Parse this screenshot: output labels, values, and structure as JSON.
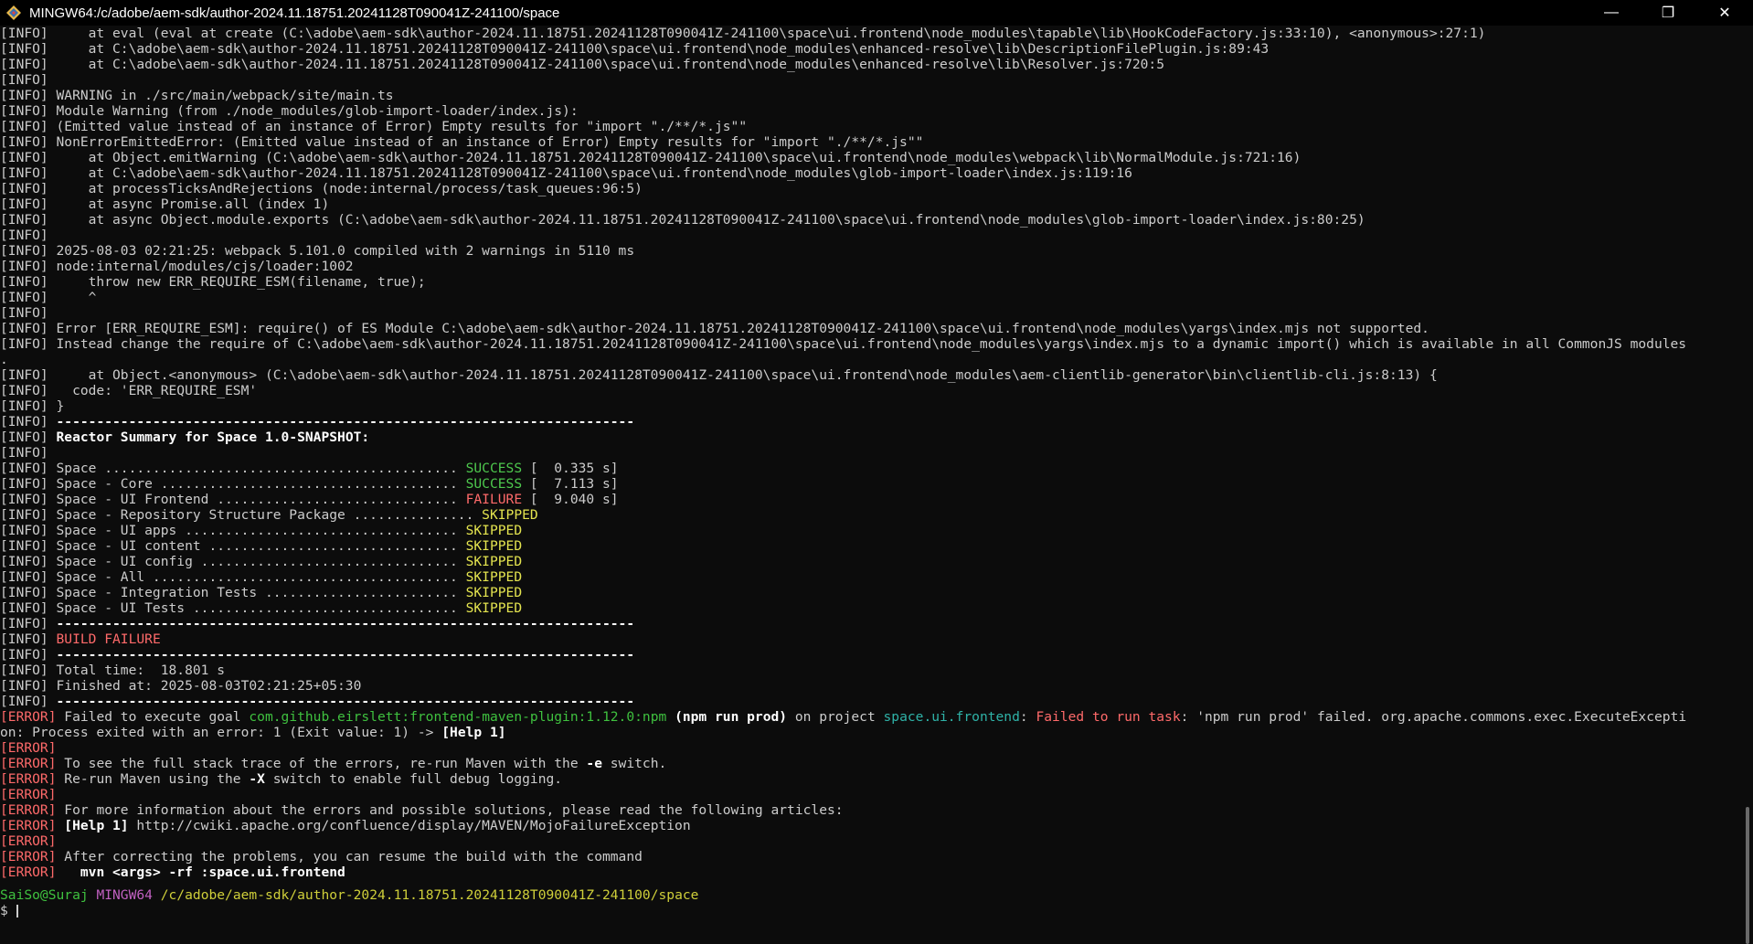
{
  "window": {
    "title": "MINGW64:/c/adobe/aem-sdk/author-2024.11.18751.20241128T090041Z-241100/space",
    "controls": {
      "minimize": "—",
      "maximize": "❐",
      "close": "✕"
    }
  },
  "terminal": {
    "lines": [
      [
        [
          "info",
          "[INFO]     at eval (eval at create (C:\\adobe\\aem-sdk\\author-2024.11.18751.20241128T090041Z-241100\\space\\ui.frontend\\node_modules\\tapable\\lib\\HookCodeFactory.js:33:10), <anonymous>:27:1)"
        ]
      ],
      [
        [
          "info",
          "[INFO]     at C:\\adobe\\aem-sdk\\author-2024.11.18751.20241128T090041Z-241100\\space\\ui.frontend\\node_modules\\enhanced-resolve\\lib\\DescriptionFilePlugin.js:89:43"
        ]
      ],
      [
        [
          "info",
          "[INFO]     at C:\\adobe\\aem-sdk\\author-2024.11.18751.20241128T090041Z-241100\\space\\ui.frontend\\node_modules\\enhanced-resolve\\lib\\Resolver.js:720:5"
        ]
      ],
      [
        [
          "info",
          "[INFO]"
        ]
      ],
      [
        [
          "info",
          "[INFO] WARNING in ./src/main/webpack/site/main.ts"
        ]
      ],
      [
        [
          "info",
          "[INFO] Module Warning (from ./node_modules/glob-import-loader/index.js):"
        ]
      ],
      [
        [
          "info",
          "[INFO] (Emitted value instead of an instance of Error) Empty results for \"import \"./**/*.js\"\""
        ]
      ],
      [
        [
          "info",
          "[INFO] NonErrorEmittedError: (Emitted value instead of an instance of Error) Empty results for \"import \"./**/*.js\"\""
        ]
      ],
      [
        [
          "info",
          "[INFO]     at Object.emitWarning (C:\\adobe\\aem-sdk\\author-2024.11.18751.20241128T090041Z-241100\\space\\ui.frontend\\node_modules\\webpack\\lib\\NormalModule.js:721:16)"
        ]
      ],
      [
        [
          "info",
          "[INFO]     at C:\\adobe\\aem-sdk\\author-2024.11.18751.20241128T090041Z-241100\\space\\ui.frontend\\node_modules\\glob-import-loader\\index.js:119:16"
        ]
      ],
      [
        [
          "info",
          "[INFO]     at processTicksAndRejections (node:internal/process/task_queues:96:5)"
        ]
      ],
      [
        [
          "info",
          "[INFO]     at async Promise.all (index 1)"
        ]
      ],
      [
        [
          "info",
          "[INFO]     at async Object.module.exports (C:\\adobe\\aem-sdk\\author-2024.11.18751.20241128T090041Z-241100\\space\\ui.frontend\\node_modules\\glob-import-loader\\index.js:80:25)"
        ]
      ],
      [
        [
          "info",
          "[INFO]"
        ]
      ],
      [
        [
          "info",
          "[INFO] 2025-08-03 02:21:25: webpack 5.101.0 compiled with 2 warnings in 5110 ms"
        ]
      ],
      [
        [
          "info",
          "[INFO] node:internal/modules/cjs/loader:1002"
        ]
      ],
      [
        [
          "info",
          "[INFO]     throw new ERR_REQUIRE_ESM(filename, true);"
        ]
      ],
      [
        [
          "info",
          "[INFO]     ^"
        ]
      ],
      [
        [
          "info",
          "[INFO]"
        ]
      ],
      [
        [
          "info",
          "[INFO] Error [ERR_REQUIRE_ESM]: require() of ES Module C:\\adobe\\aem-sdk\\author-2024.11.18751.20241128T090041Z-241100\\space\\ui.frontend\\node_modules\\yargs\\index.mjs not supported."
        ]
      ],
      [
        [
          "info",
          "[INFO] Instead change the require of C:\\adobe\\aem-sdk\\author-2024.11.18751.20241128T090041Z-241100\\space\\ui.frontend\\node_modules\\yargs\\index.mjs to a dynamic import() which is available in all CommonJS modules"
        ]
      ],
      [
        [
          "info",
          "."
        ]
      ],
      [
        [
          "info",
          "[INFO]     at Object.<anonymous> (C:\\adobe\\aem-sdk\\author-2024.11.18751.20241128T090041Z-241100\\space\\ui.frontend\\node_modules\\aem-clientlib-generator\\bin\\clientlib-cli.js:8:13) {"
        ]
      ],
      [
        [
          "info",
          "[INFO]   code: 'ERR_REQUIRE_ESM'"
        ]
      ],
      [
        [
          "info",
          "[INFO] }"
        ]
      ],
      [
        [
          "info",
          "[INFO] "
        ],
        [
          "bold",
          "------------------------------------------------------------------------"
        ]
      ],
      [
        [
          "info",
          "[INFO] "
        ],
        [
          "bold",
          "Reactor Summary for Space 1.0-SNAPSHOT:"
        ]
      ],
      [
        [
          "info",
          "[INFO]"
        ]
      ],
      [
        [
          "info",
          "[INFO] Space ............................................ "
        ],
        [
          "success",
          "SUCCESS"
        ],
        [
          "info",
          " [  0.335 s]"
        ]
      ],
      [
        [
          "info",
          "[INFO] Space - Core ..................................... "
        ],
        [
          "success",
          "SUCCESS"
        ],
        [
          "info",
          " [  7.113 s]"
        ]
      ],
      [
        [
          "info",
          "[INFO] Space - UI Frontend .............................. "
        ],
        [
          "fail",
          "FAILURE"
        ],
        [
          "info",
          " [  9.040 s]"
        ]
      ],
      [
        [
          "info",
          "[INFO] Space - Repository Structure Package ............... "
        ],
        [
          "skip",
          "SKIPPED"
        ]
      ],
      [
        [
          "info",
          "[INFO] Space - UI apps .................................. "
        ],
        [
          "skip",
          "SKIPPED"
        ]
      ],
      [
        [
          "info",
          "[INFO] Space - UI content ............................... "
        ],
        [
          "skip",
          "SKIPPED"
        ]
      ],
      [
        [
          "info",
          "[INFO] Space - UI config ................................ "
        ],
        [
          "skip",
          "SKIPPED"
        ]
      ],
      [
        [
          "info",
          "[INFO] Space - All ...................................... "
        ],
        [
          "skip",
          "SKIPPED"
        ]
      ],
      [
        [
          "info",
          "[INFO] Space - Integration Tests ........................ "
        ],
        [
          "skip",
          "SKIPPED"
        ]
      ],
      [
        [
          "info",
          "[INFO] Space - UI Tests ................................. "
        ],
        [
          "skip",
          "SKIPPED"
        ]
      ],
      [
        [
          "info",
          "[INFO] "
        ],
        [
          "bold",
          "------------------------------------------------------------------------"
        ]
      ],
      [
        [
          "info",
          "[INFO] "
        ],
        [
          "fail",
          "BUILD FAILURE"
        ]
      ],
      [
        [
          "info",
          "[INFO] "
        ],
        [
          "bold",
          "------------------------------------------------------------------------"
        ]
      ],
      [
        [
          "info",
          "[INFO] Total time:  18.801 s"
        ]
      ],
      [
        [
          "info",
          "[INFO] Finished at: 2025-08-03T02:21:25+05:30"
        ]
      ],
      [
        [
          "info",
          "[INFO] "
        ],
        [
          "bold",
          "------------------------------------------------------------------------"
        ]
      ],
      [
        [
          "error",
          "[ERROR]"
        ],
        [
          "info",
          " Failed to execute goal "
        ],
        [
          "green",
          "com.github.eirslett:frontend-maven-plugin:1.12.0:npm"
        ],
        [
          "bold",
          " (npm run prod)"
        ],
        [
          "info",
          " on project "
        ],
        [
          "teal",
          "space.ui.frontend"
        ],
        [
          "info",
          ": "
        ],
        [
          "fail",
          "Failed to run task"
        ],
        [
          "info",
          ": 'npm run prod' failed. org.apache.commons.exec.ExecuteExcepti"
        ]
      ],
      [
        [
          "info",
          "on: Process exited with an error: 1 (Exit value: 1) -> "
        ],
        [
          "bold",
          "[Help 1]"
        ]
      ],
      [
        [
          "error",
          "[ERROR]"
        ]
      ],
      [
        [
          "error",
          "[ERROR]"
        ],
        [
          "info",
          " To see the full stack trace of the errors, re-run Maven with the "
        ],
        [
          "bold",
          "-e"
        ],
        [
          "info",
          " switch."
        ]
      ],
      [
        [
          "error",
          "[ERROR]"
        ],
        [
          "info",
          " Re-run Maven using the "
        ],
        [
          "bold",
          "-X"
        ],
        [
          "info",
          " switch to enable full debug logging."
        ]
      ],
      [
        [
          "error",
          "[ERROR]"
        ]
      ],
      [
        [
          "error",
          "[ERROR]"
        ],
        [
          "info",
          " For more information about the errors and possible solutions, please read the following articles:"
        ]
      ],
      [
        [
          "error",
          "[ERROR]"
        ],
        [
          "bold",
          " [Help 1]"
        ],
        [
          "info",
          " http://cwiki.apache.org/confluence/display/MAVEN/MojoFailureException"
        ]
      ],
      [
        [
          "error",
          "[ERROR]"
        ]
      ],
      [
        [
          "error",
          "[ERROR]"
        ],
        [
          "info",
          " After correcting the problems, you can resume the build with the command"
        ]
      ],
      [
        [
          "error",
          "[ERROR]"
        ],
        [
          "bold",
          "   mvn <args> -rf :space.ui.frontend"
        ]
      ]
    ],
    "prompt": {
      "user": "SaiSo@Suraj",
      "system": "MINGW64",
      "path": "/c/adobe/aem-sdk/author-2024.11.18751.20241128T090041Z-241100/space",
      "symbol": "$ "
    }
  },
  "colors": {
    "background": "#0c0c0c",
    "info": "#cccccc",
    "error": "#ff6a6a",
    "success": "#4ec94e",
    "skipped": "#e4e44f",
    "teal": "#2fb3a8"
  }
}
